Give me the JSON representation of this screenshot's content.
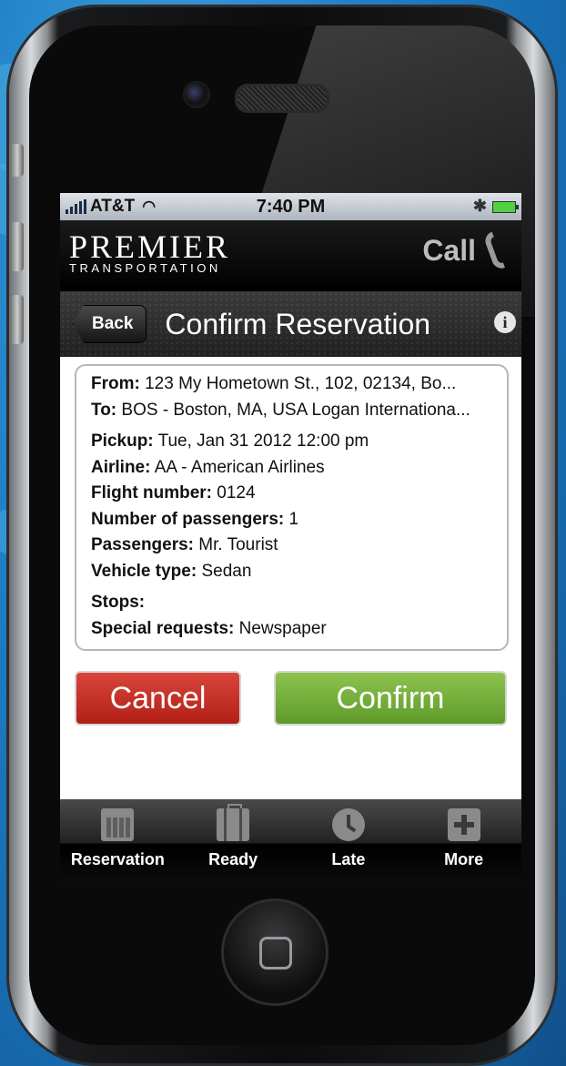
{
  "status_bar": {
    "carrier": "AT&T",
    "time": "7:40 PM"
  },
  "header": {
    "brand_main": "PREMIER",
    "brand_sub": "TRANSPORTATION",
    "call_label": "Call"
  },
  "nav": {
    "back_label": "Back",
    "title": "Confirm Reservation"
  },
  "reservation": {
    "from_label": "From:",
    "from_value": "123 My Hometown St., 102, 02134, Bo...",
    "to_label": "To:",
    "to_value": "BOS - Boston, MA, USA Logan Internationa...",
    "pickup_label": "Pickup:",
    "pickup_value": "Tue, Jan 31 2012 12:00 pm",
    "airline_label": "Airline:",
    "airline_value": "AA - American Airlines",
    "flight_label": "Flight number:",
    "flight_value": "0124",
    "passengers_count_label": "Number of passengers:",
    "passengers_count_value": "1",
    "passengers_label": "Passengers:",
    "passengers_value": "Mr. Tourist",
    "vehicle_label": "Vehicle type:",
    "vehicle_value": "Sedan",
    "stops_label": "Stops:",
    "stops_value": "",
    "requests_label": "Special requests:",
    "requests_value": "Newspaper"
  },
  "actions": {
    "cancel_label": "Cancel",
    "confirm_label": "Confirm"
  },
  "tabbar": {
    "items": [
      {
        "label": "Reservation",
        "icon": "calendar-icon"
      },
      {
        "label": "Ready",
        "icon": "briefcase-icon"
      },
      {
        "label": "Late",
        "icon": "clock-icon"
      },
      {
        "label": "More",
        "icon": "plus-icon"
      }
    ]
  },
  "colors": {
    "cancel": "#c2302a",
    "confirm": "#78b03c",
    "background": "#1f7fc6"
  }
}
